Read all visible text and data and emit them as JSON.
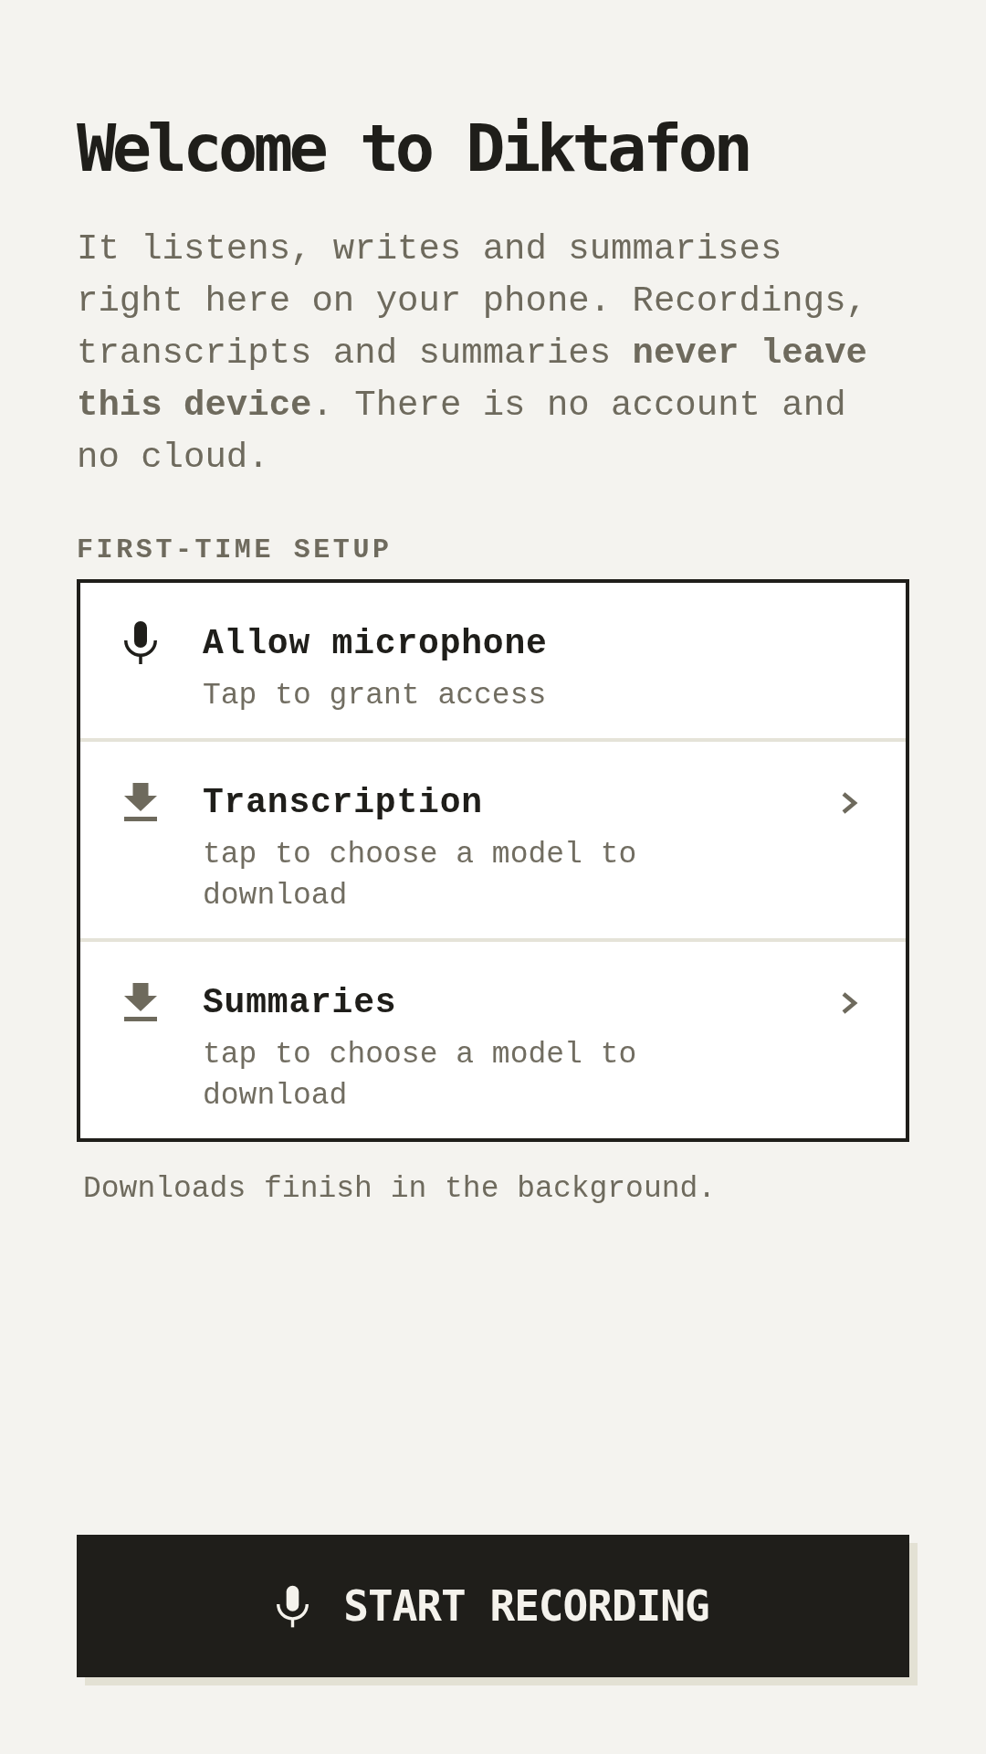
{
  "title": "Welcome to Diktafon",
  "intro": "It listens, writes and summarises right here on your phone. Recordings, transcripts and summaries **never leave this device**. There is no account and no cloud.",
  "setup": {
    "heading": "FIRST-TIME SETUP",
    "items": [
      {
        "kind": "permission",
        "title": "Allow microphone",
        "subtitle": "Tap to grant access"
      },
      {
        "kind": "download",
        "title": "Transcription",
        "subtitle": "tap to choose a model to download"
      },
      {
        "kind": "download",
        "title": "Summaries",
        "subtitle": "tap to choose a model to download"
      }
    ],
    "note": "Downloads finish in the background."
  },
  "record_button": {
    "label": "START RECORDING"
  }
}
